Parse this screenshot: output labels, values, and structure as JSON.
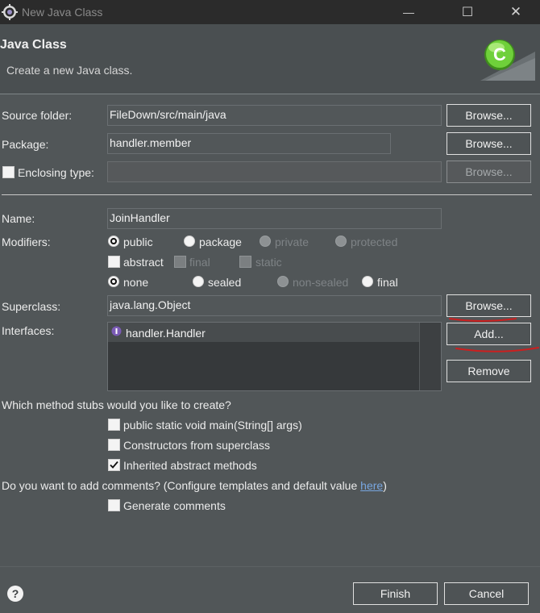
{
  "window": {
    "title": "New Java Class",
    "minimize_glyph": "—",
    "maximize_glyph": "☐",
    "close_glyph": "✕"
  },
  "header": {
    "title": "Java Class",
    "subtitle": "Create a new Java class.",
    "logo_letter": "C",
    "logo_color": "#6fd03a"
  },
  "form": {
    "source_folder": {
      "label": "Source folder:",
      "value": "FileDown/src/main/java",
      "browse": "Browse..."
    },
    "package": {
      "label": "Package:",
      "value": "handler.member",
      "browse": "Browse..."
    },
    "enclosing_type": {
      "label": "Enclosing type:",
      "checked": false,
      "value": "",
      "browse": "Browse..."
    },
    "name": {
      "label": "Name:",
      "value": "JoinHandler"
    },
    "modifiers": {
      "label": "Modifiers:",
      "access": [
        "public",
        "package",
        "private",
        "protected"
      ],
      "access_selected": "public",
      "flags": [
        "abstract",
        "final",
        "static"
      ],
      "inheritance": [
        "none",
        "sealed",
        "non-sealed",
        "final"
      ],
      "inheritance_selected": "none"
    },
    "superclass": {
      "label": "Superclass:",
      "value": "java.lang.Object",
      "browse": "Browse..."
    },
    "interfaces": {
      "label": "Interfaces:",
      "items": [
        "handler.Handler"
      ],
      "add": "Add...",
      "remove": "Remove"
    },
    "stubs": {
      "question": "Which method stubs would you like to create?",
      "main": {
        "label": "public static void main(String[] args)",
        "checked": false
      },
      "constructors": {
        "label": "Constructors from superclass",
        "checked": false
      },
      "inherited": {
        "label": "Inherited abstract methods",
        "checked": true
      }
    },
    "comments": {
      "question": "Do you want to add comments? (Configure templates and default value ",
      "link": "here",
      "question_end": ")",
      "generate": {
        "label": "Generate comments",
        "checked": false
      }
    }
  },
  "footer": {
    "help": "?",
    "finish": "Finish",
    "cancel": "Cancel"
  },
  "annotation_color": "#cc1f1f"
}
